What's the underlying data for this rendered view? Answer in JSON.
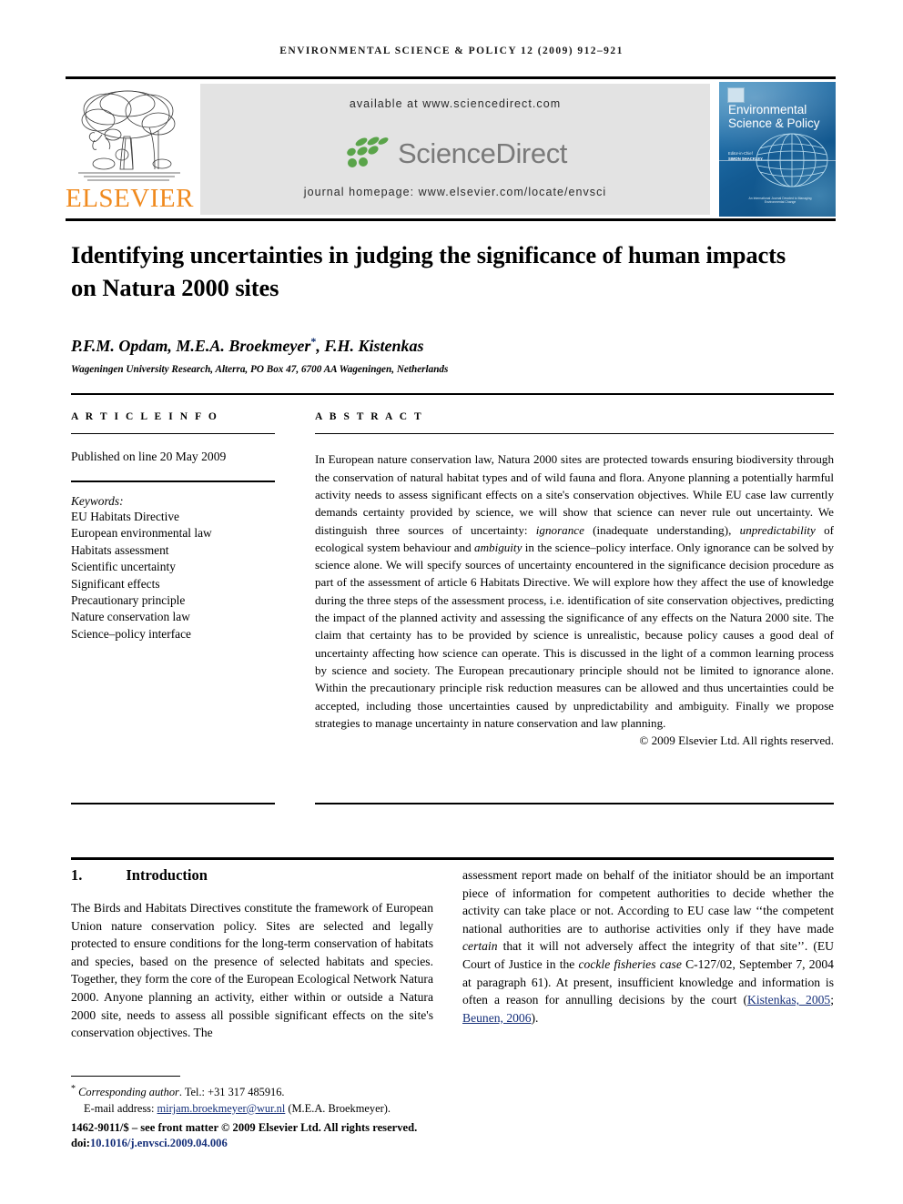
{
  "running_head": "Environmental Science & Policy 12 (2009) 912–921",
  "masthead": {
    "elsevier_wordmark": "ELSEVIER",
    "available_at": "available at www.sciencedirect.com",
    "sciencedirect_logo_text": "ScienceDirect",
    "journal_homepage": "journal homepage: www.elsevier.com/locate/envsci",
    "cover": {
      "title": "Environmental Science & Policy",
      "editor_label": "Editor-in-Chief",
      "editor_name": "SIMON SHACKLEY",
      "footer_note": "An International Journal Devoted to Managing Environmental Change"
    }
  },
  "article": {
    "title": "Identifying uncertainties in judging the significance of human impacts on Natura 2000 sites",
    "authors": "P.F.M. Opdam, M.E.A. Broekmeyer",
    "authors_tail": ", F.H. Kistenkas",
    "corresponding_marker": "*",
    "affiliation": "Wageningen University Research, Alterra, PO Box 47, 6700 AA Wageningen, Netherlands"
  },
  "article_info": {
    "heading": "A R T I C L E  I N F O",
    "published": "Published on line 20 May 2009",
    "keywords_label": "Keywords:",
    "keywords": [
      "EU Habitats Directive",
      "European environmental law",
      "Habitats assessment",
      "Scientific uncertainty",
      "Significant effects",
      "Precautionary principle",
      "Nature conservation law",
      "Science–policy interface"
    ]
  },
  "abstract": {
    "heading": "A B S T R A C T",
    "text_part1": "In European nature conservation law, Natura 2000 sites are protected towards ensuring biodiversity through the conservation of natural habitat types and of wild fauna and flora. Anyone planning a potentially harmful activity needs to assess significant effects on a site's conservation objectives. While EU case law currently demands certainty provided by science, we will show that science can never rule out uncertainty. We distinguish three sources of uncertainty: ",
    "em1": "ignorance",
    "text_part2": " (inadequate understanding), ",
    "em2": "unpredictability",
    "text_part3": " of ecological system behaviour and ",
    "em3": "ambiguity",
    "text_part4": " in the science–policy interface. Only ignorance can be solved by science alone. We will specify sources of uncertainty encountered in the significance decision procedure as part of the assessment of article 6 Habitats Directive. We will explore how they affect the use of knowledge during the three steps of the assessment process, i.e. identification of site conservation objectives, predicting the impact of the planned activity and assessing the significance of any effects on the Natura 2000 site. The claim that certainty has to be provided by science is unrealistic, because policy causes a good deal of uncertainty affecting how science can operate. This is discussed in the light of a common learning process by science and society. The European precautionary principle should not be limited to ignorance alone. Within the precautionary principle risk reduction measures can be allowed and thus uncertainties could be accepted, including those uncertainties caused by unpredictability and ambiguity. Finally we propose strategies to manage uncertainty in nature conservation and law planning.",
    "copyright": "© 2009 Elsevier Ltd. All rights reserved."
  },
  "section": {
    "number": "1.",
    "title": "Introduction",
    "left_column": "The Birds and Habitats Directives constitute the framework of European Union nature conservation policy. Sites are selected and legally protected to ensure conditions for the long-term conservation of habitats and species, based on the presence of selected habitats and species. Together, they form the core of the European Ecological Network Natura 2000. Anyone planning an activity, either within or outside a Natura 2000 site, needs to assess all possible significant effects on the site's conservation objectives. The",
    "right_part1": "assessment report made on behalf of the initiator should be an important piece of information for competent authorities to decide whether the activity can take place or not. According to EU case law ‘‘the competent national authorities are to authorise activities only if they have made ",
    "right_em1": "certain",
    "right_part2": " that it will not adversely affect the integrity of that site’’. (EU Court of Justice in the ",
    "right_em2": "cockle fisheries case",
    "right_part3": " C-127/02, September 7, 2004 at paragraph 61). At present, insufficient knowledge and information is often a reason for annulling decisions by the court (",
    "right_ref1": "Kistenkas, 2005",
    "right_sep": "; ",
    "right_ref2": "Beunen, 2006",
    "right_part4": ")."
  },
  "footnote": {
    "marker": "*",
    "corresponding_label": "Corresponding author",
    "tel": ". Tel.: +31 317 485916.",
    "email_label": "E-mail address: ",
    "email": "mirjam.broekmeyer@wur.nl",
    "email_owner": " (M.E.A. Broekmeyer).",
    "frontmatter": "1462-9011/$ – see front matter © 2009 Elsevier Ltd. All rights reserved.",
    "doi_label": "doi:",
    "doi": "10.1016/j.envsci.2009.04.006"
  }
}
